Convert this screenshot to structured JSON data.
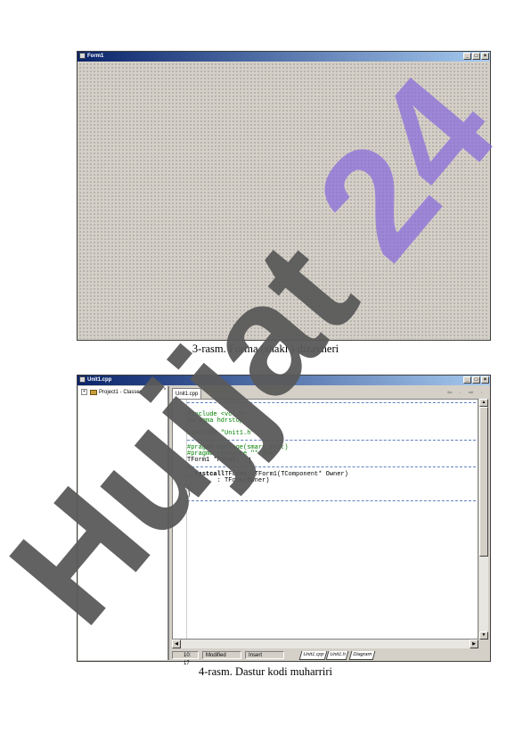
{
  "figure3": {
    "window_title": "Form1",
    "caption": "3-rasm. Forma (shakl ) dizayneri"
  },
  "figure4": {
    "window_title": "Unit1.cpp",
    "tree_item": "Project1 - Classes",
    "tab": "Unit1.cpp",
    "code_lines": [
      "//-------------------------------------------------------------------",
      "#include <vcl.h>",
      "#pragma hdrstop",
      "#include \"Unit1.h\"",
      "#pragma package(smart_init)",
      "#pragma resource \"*.dfm\"",
      "TForm1 *Form1;",
      "__fastcall",
      " TForm1::TForm1(TComponent* Owner)",
      "        : TForm(Owner)",
      "{",
      "}",
      "//-------------------------------------------------------------------"
    ],
    "status_position": "10: 17",
    "status_state": "Modified",
    "status_mode": "Insert",
    "bottom_tabs": [
      "Unit1.cpp",
      "Unit1.h",
      "Diagram"
    ],
    "caption": "4-rasm. Dastur kodi muharriri"
  },
  "watermark": {
    "text": "Hujjat 24",
    "color_dark": "#5a5a5a",
    "color_accent": "#8866dd"
  },
  "colors": {
    "titlebar_start": "#0a246a",
    "titlebar_end": "#a6caf0",
    "face": "#d4d0c8"
  }
}
